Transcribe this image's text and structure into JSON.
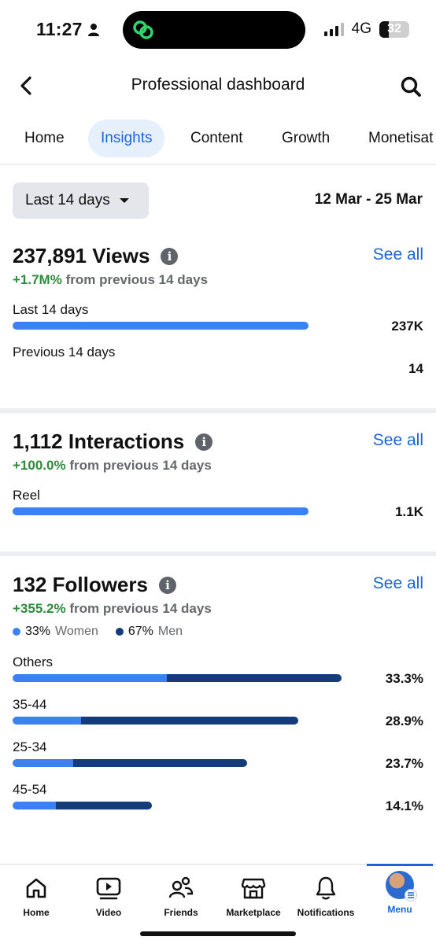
{
  "status_bar": {
    "time": "11:27",
    "network": "4G",
    "battery": "32",
    "battery_level": 0.32
  },
  "header": {
    "title": "Professional dashboard",
    "back_icon": "chevron-left-icon",
    "search_icon": "search-icon"
  },
  "tabs": [
    {
      "label": "Home",
      "active": false
    },
    {
      "label": "Insights",
      "active": true
    },
    {
      "label": "Content",
      "active": false
    },
    {
      "label": "Growth",
      "active": false
    },
    {
      "label": "Monetisat",
      "active": false
    }
  ],
  "filter": {
    "range_label": "Last 14 days",
    "date_range": "12 Mar - 25 Mar"
  },
  "views": {
    "title": "237,891 Views",
    "see_all": "See all",
    "delta_pct": "+1.7M%",
    "delta_rest": "from previous 14 days",
    "rows": [
      {
        "label": "Last 14 days",
        "value": "237K",
        "fraction": 1.0
      },
      {
        "label": "Previous 14 days",
        "value": "14",
        "fraction": 0.0
      }
    ]
  },
  "interactions": {
    "title": "1,112 Interactions",
    "see_all": "See all",
    "delta_pct": "+100.0%",
    "delta_rest": "from previous 14 days",
    "rows": [
      {
        "label": "Reel",
        "value": "1.1K",
        "fraction": 1.0
      }
    ]
  },
  "followers": {
    "title": "132 Followers",
    "see_all": "See all",
    "delta_pct": "+355.2%",
    "delta_rest": "from previous 14 days",
    "legend": [
      {
        "pct": "33%",
        "label": "Women",
        "color": "#3b82f0"
      },
      {
        "pct": "67%",
        "label": "Men",
        "color": "#143c7a"
      }
    ],
    "rows": [
      {
        "label": "Others",
        "value": "33.3%",
        "fraction": 1.0,
        "women_share": 0.47
      },
      {
        "label": "35-44",
        "value": "28.9%",
        "fraction": 0.868,
        "women_share": 0.24
      },
      {
        "label": "25-34",
        "value": "23.7%",
        "fraction": 0.712,
        "women_share": 0.26
      },
      {
        "label": "45-54",
        "value": "14.1%",
        "fraction": 0.423,
        "women_share": 0.31
      }
    ]
  },
  "colors": {
    "accent": "#1b64d8",
    "bar_light": "#3b82f0",
    "bar_dark": "#143c7a",
    "positive": "#2f8a3e"
  },
  "bottom_nav": [
    {
      "label": "Home",
      "icon": "home-icon",
      "active": false
    },
    {
      "label": "Video",
      "icon": "video-icon",
      "active": false
    },
    {
      "label": "Friends",
      "icon": "friends-icon",
      "active": false
    },
    {
      "label": "Marketplace",
      "icon": "marketplace-icon",
      "active": false
    },
    {
      "label": "Notifications",
      "icon": "bell-icon",
      "active": false
    },
    {
      "label": "Menu",
      "icon": "avatar",
      "active": true
    }
  ]
}
